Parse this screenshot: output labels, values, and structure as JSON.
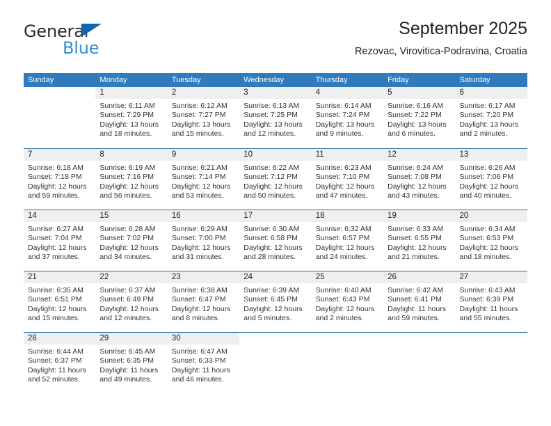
{
  "brand": {
    "name_part1": "General",
    "name_part2": "Blue",
    "logo_icon": "triangle-flag-icon"
  },
  "header": {
    "title": "September 2025",
    "subtitle": "Rezovac, Virovitica-Podravina, Croatia"
  },
  "colors": {
    "header_blue": "#2f7bbd",
    "row_divider_blue": "#2f6fa8",
    "day_band_gray": "#efefef",
    "brand_blue_dark": "#1266b0",
    "brand_blue_light": "#2f8fd6"
  },
  "calendar": {
    "weekday_headers": [
      "Sunday",
      "Monday",
      "Tuesday",
      "Wednesday",
      "Thursday",
      "Friday",
      "Saturday"
    ],
    "weeks": [
      [
        {
          "day": "",
          "lines": []
        },
        {
          "day": "1",
          "lines": [
            "Sunrise: 6:11 AM",
            "Sunset: 7:29 PM",
            "Daylight: 13 hours",
            "and 18 minutes."
          ]
        },
        {
          "day": "2",
          "lines": [
            "Sunrise: 6:12 AM",
            "Sunset: 7:27 PM",
            "Daylight: 13 hours",
            "and 15 minutes."
          ]
        },
        {
          "day": "3",
          "lines": [
            "Sunrise: 6:13 AM",
            "Sunset: 7:25 PM",
            "Daylight: 13 hours",
            "and 12 minutes."
          ]
        },
        {
          "day": "4",
          "lines": [
            "Sunrise: 6:14 AM",
            "Sunset: 7:24 PM",
            "Daylight: 13 hours",
            "and 9 minutes."
          ]
        },
        {
          "day": "5",
          "lines": [
            "Sunrise: 6:16 AM",
            "Sunset: 7:22 PM",
            "Daylight: 13 hours",
            "and 6 minutes."
          ]
        },
        {
          "day": "6",
          "lines": [
            "Sunrise: 6:17 AM",
            "Sunset: 7:20 PM",
            "Daylight: 13 hours",
            "and 2 minutes."
          ]
        }
      ],
      [
        {
          "day": "7",
          "lines": [
            "Sunrise: 6:18 AM",
            "Sunset: 7:18 PM",
            "Daylight: 12 hours",
            "and 59 minutes."
          ]
        },
        {
          "day": "8",
          "lines": [
            "Sunrise: 6:19 AM",
            "Sunset: 7:16 PM",
            "Daylight: 12 hours",
            "and 56 minutes."
          ]
        },
        {
          "day": "9",
          "lines": [
            "Sunrise: 6:21 AM",
            "Sunset: 7:14 PM",
            "Daylight: 12 hours",
            "and 53 minutes."
          ]
        },
        {
          "day": "10",
          "lines": [
            "Sunrise: 6:22 AM",
            "Sunset: 7:12 PM",
            "Daylight: 12 hours",
            "and 50 minutes."
          ]
        },
        {
          "day": "11",
          "lines": [
            "Sunrise: 6:23 AM",
            "Sunset: 7:10 PM",
            "Daylight: 12 hours",
            "and 47 minutes."
          ]
        },
        {
          "day": "12",
          "lines": [
            "Sunrise: 6:24 AM",
            "Sunset: 7:08 PM",
            "Daylight: 12 hours",
            "and 43 minutes."
          ]
        },
        {
          "day": "13",
          "lines": [
            "Sunrise: 6:26 AM",
            "Sunset: 7:06 PM",
            "Daylight: 12 hours",
            "and 40 minutes."
          ]
        }
      ],
      [
        {
          "day": "14",
          "lines": [
            "Sunrise: 6:27 AM",
            "Sunset: 7:04 PM",
            "Daylight: 12 hours",
            "and 37 minutes."
          ]
        },
        {
          "day": "15",
          "lines": [
            "Sunrise: 6:28 AM",
            "Sunset: 7:02 PM",
            "Daylight: 12 hours",
            "and 34 minutes."
          ]
        },
        {
          "day": "16",
          "lines": [
            "Sunrise: 6:29 AM",
            "Sunset: 7:00 PM",
            "Daylight: 12 hours",
            "and 31 minutes."
          ]
        },
        {
          "day": "17",
          "lines": [
            "Sunrise: 6:30 AM",
            "Sunset: 6:58 PM",
            "Daylight: 12 hours",
            "and 28 minutes."
          ]
        },
        {
          "day": "18",
          "lines": [
            "Sunrise: 6:32 AM",
            "Sunset: 6:57 PM",
            "Daylight: 12 hours",
            "and 24 minutes."
          ]
        },
        {
          "day": "19",
          "lines": [
            "Sunrise: 6:33 AM",
            "Sunset: 6:55 PM",
            "Daylight: 12 hours",
            "and 21 minutes."
          ]
        },
        {
          "day": "20",
          "lines": [
            "Sunrise: 6:34 AM",
            "Sunset: 6:53 PM",
            "Daylight: 12 hours",
            "and 18 minutes."
          ]
        }
      ],
      [
        {
          "day": "21",
          "lines": [
            "Sunrise: 6:35 AM",
            "Sunset: 6:51 PM",
            "Daylight: 12 hours",
            "and 15 minutes."
          ]
        },
        {
          "day": "22",
          "lines": [
            "Sunrise: 6:37 AM",
            "Sunset: 6:49 PM",
            "Daylight: 12 hours",
            "and 12 minutes."
          ]
        },
        {
          "day": "23",
          "lines": [
            "Sunrise: 6:38 AM",
            "Sunset: 6:47 PM",
            "Daylight: 12 hours",
            "and 8 minutes."
          ]
        },
        {
          "day": "24",
          "lines": [
            "Sunrise: 6:39 AM",
            "Sunset: 6:45 PM",
            "Daylight: 12 hours",
            "and 5 minutes."
          ]
        },
        {
          "day": "25",
          "lines": [
            "Sunrise: 6:40 AM",
            "Sunset: 6:43 PM",
            "Daylight: 12 hours",
            "and 2 minutes."
          ]
        },
        {
          "day": "26",
          "lines": [
            "Sunrise: 6:42 AM",
            "Sunset: 6:41 PM",
            "Daylight: 11 hours",
            "and 59 minutes."
          ]
        },
        {
          "day": "27",
          "lines": [
            "Sunrise: 6:43 AM",
            "Sunset: 6:39 PM",
            "Daylight: 11 hours",
            "and 55 minutes."
          ]
        }
      ],
      [
        {
          "day": "28",
          "lines": [
            "Sunrise: 6:44 AM",
            "Sunset: 6:37 PM",
            "Daylight: 11 hours",
            "and 52 minutes."
          ]
        },
        {
          "day": "29",
          "lines": [
            "Sunrise: 6:45 AM",
            "Sunset: 6:35 PM",
            "Daylight: 11 hours",
            "and 49 minutes."
          ]
        },
        {
          "day": "30",
          "lines": [
            "Sunrise: 6:47 AM",
            "Sunset: 6:33 PM",
            "Daylight: 11 hours",
            "and 46 minutes."
          ]
        },
        {
          "day": "",
          "lines": []
        },
        {
          "day": "",
          "lines": []
        },
        {
          "day": "",
          "lines": []
        },
        {
          "day": "",
          "lines": []
        }
      ]
    ]
  }
}
